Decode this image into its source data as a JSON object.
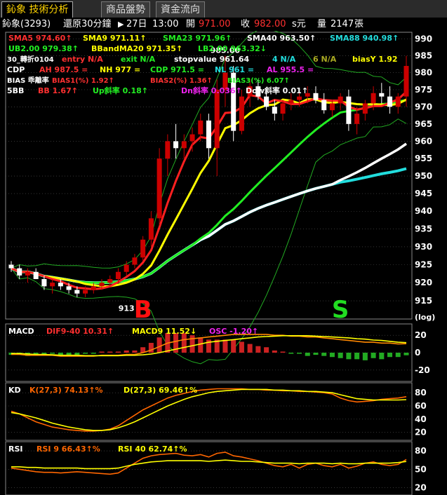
{
  "tabs": [
    {
      "label": "鈊象 技術分析",
      "active": true
    },
    {
      "label": "商品盤勢",
      "active": false
    },
    {
      "label": "資金流向",
      "active": false
    }
  ],
  "header": {
    "symbol": "鈊象(3293)",
    "period": "還原30分鐘",
    "day": "27日",
    "time": "13:00",
    "open_label": "開",
    "open": "971.00",
    "close_label": "收",
    "close": "982.00",
    "unit": "s元",
    "volume_label": "量",
    "volume": "2147",
    "volume_unit": "張"
  },
  "colors": {
    "sma5": "#ff2020",
    "sma9": "#ffff00",
    "sma23": "#22ee22",
    "sma40": "#ffffff",
    "sma88": "#22dddd",
    "up": "#cc0000",
    "down": "#ffffff",
    "grid": "#555",
    "border": "#888"
  },
  "indicators": [
    [
      {
        "t": "SMA5 974.60↑",
        "c": "#ff3030"
      },
      {
        "t": "SMA9 971.11↑",
        "c": "#ffff00"
      },
      {
        "t": "SMA23 971.96↑",
        "c": "#22ee22"
      },
      {
        "t": "SMA40 963.50↑",
        "c": "#ffffff"
      },
      {
        "t": "SMA88 940.98↑",
        "c": "#22dddd"
      }
    ],
    [
      {
        "t": "UB2.00 979.38↑",
        "c": "#22ee22"
      },
      {
        "t": "BBandMA20 971.35↑",
        "c": "#ffff00"
      },
      {
        "t": "LB2.00 963.32↓",
        "c": "#22ee22"
      }
    ],
    [
      {
        "t": "30_轉折0104",
        "c": "#ffffff"
      },
      {
        "t": "entry N/A",
        "c": "#ff3030"
      },
      {
        "t": "exit N/A",
        "c": "#22ee22"
      },
      {
        "t": "stopvalue 961.64",
        "c": "#ffffff"
      },
      {
        "t": "4 N/A",
        "c": "#22dddd"
      },
      {
        "t": "6 N/A",
        "c": "#aaaa22"
      },
      {
        "t": "biasY 1.92",
        "c": "#ffff00"
      }
    ],
    [
      {
        "t": "CDP",
        "c": "#ffffff"
      },
      {
        "t": "AH 987.5 =",
        "c": "#ff3030"
      },
      {
        "t": "NH 977 =",
        "c": "#ffff00"
      },
      {
        "t": "CDP 971.5 =",
        "c": "#22ee22"
      },
      {
        "t": "NL 961 =",
        "c": "#22dddd"
      },
      {
        "t": "AL 955.5 =",
        "c": "#ee22ee"
      }
    ],
    [
      {
        "t": "BIAS 乖離率",
        "c": "#ffffff"
      },
      {
        "t": "BIAS1(%) 1.92↑",
        "c": "#ff3030"
      },
      {
        "t": "BIAS2(%) 1.36↑",
        "c": "#ff3030"
      },
      {
        "t": "BIAS3(%) 6.07↑",
        "c": "#22ee22"
      }
    ],
    [
      {
        "t": "5BB",
        "c": "#ffffff"
      },
      {
        "t": "BB 1.67↑",
        "c": "#ff3030"
      },
      {
        "t": "Up斜率 0.18↑",
        "c": "#22ee22"
      },
      {
        "t": "Dn斜率 0.036↑",
        "c": "#ee22ee"
      },
      {
        "t": "Dow斜率 0.01↑",
        "c": "#ffffff"
      }
    ]
  ],
  "markers": {
    "buy": "B",
    "sell": "S",
    "low_label": "913",
    "high_label": "985.00"
  },
  "chart_data": [
    {
      "type": "candlestick",
      "y_ticks": [
        990,
        985,
        980,
        975,
        970,
        965,
        960,
        955,
        950,
        945,
        940,
        935,
        930,
        925,
        920,
        915
      ],
      "ylim": [
        910,
        992
      ],
      "y_scale": "log",
      "scale_label": "(log)",
      "candles": [
        [
          925,
          926,
          923,
          924
        ],
        [
          924,
          925,
          921,
          922
        ],
        [
          922,
          924,
          920,
          923
        ],
        [
          923,
          924,
          921,
          921
        ],
        [
          921,
          922,
          918,
          919
        ],
        [
          919,
          921,
          917,
          920
        ],
        [
          920,
          921,
          918,
          919
        ],
        [
          919,
          920,
          917,
          918
        ],
        [
          918,
          919,
          916,
          917
        ],
        [
          917,
          919,
          916,
          918
        ],
        [
          918,
          920,
          917,
          919
        ],
        [
          919,
          921,
          918,
          920
        ],
        [
          920,
          922,
          919,
          921
        ],
        [
          921,
          924,
          920,
          923
        ],
        [
          923,
          926,
          922,
          925
        ],
        [
          925,
          928,
          924,
          927
        ],
        [
          927,
          933,
          926,
          932
        ],
        [
          932,
          940,
          930,
          938
        ],
        [
          938,
          958,
          936,
          955
        ],
        [
          955,
          962,
          950,
          960
        ],
        [
          960,
          965,
          955,
          958
        ],
        [
          958,
          962,
          955,
          960
        ],
        [
          960,
          964,
          957,
          962
        ],
        [
          962,
          968,
          960,
          966
        ],
        [
          966,
          968,
          955,
          958
        ],
        [
          958,
          978,
          950,
          975
        ],
        [
          975,
          985,
          970,
          980
        ],
        [
          980,
          982,
          960,
          963
        ],
        [
          963,
          975,
          962,
          973
        ],
        [
          973,
          978,
          970,
          976
        ],
        [
          976,
          978,
          972,
          973
        ],
        [
          973,
          975,
          969,
          970
        ],
        [
          970,
          972,
          966,
          968
        ],
        [
          968,
          972,
          966,
          971
        ],
        [
          971,
          974,
          969,
          972
        ],
        [
          972,
          975,
          970,
          973
        ],
        [
          973,
          976,
          971,
          974
        ],
        [
          974,
          976,
          971,
          972
        ],
        [
          972,
          974,
          968,
          969
        ],
        [
          969,
          972,
          967,
          971
        ],
        [
          971,
          974,
          969,
          973
        ],
        [
          973,
          975,
          963,
          965
        ],
        [
          965,
          970,
          962,
          968
        ],
        [
          968,
          972,
          966,
          971
        ],
        [
          971,
          976,
          969,
          974
        ],
        [
          974,
          977,
          971,
          973
        ],
        [
          973,
          976,
          968,
          970
        ],
        [
          970,
          974,
          968,
          973
        ],
        [
          973,
          985,
          970,
          982
        ]
      ]
    },
    {
      "type": "line",
      "name": "MACD",
      "labels": [
        {
          "t": "MACD",
          "c": "#ffffff"
        },
        {
          "t": "DIF9-40 10.31↑",
          "c": "#ff3030"
        },
        {
          "t": "MACD9 11.52↓",
          "c": "#ffff00"
        },
        {
          "t": "OSC -1.20↑",
          "c": "#ee22ee"
        }
      ],
      "y_ticks": [
        20,
        0,
        -20
      ],
      "ylim": [
        -33,
        33
      ],
      "dif": [
        -2,
        -2,
        -3,
        -3,
        -3,
        -3,
        -4,
        -4,
        -4,
        -4,
        -4,
        -3,
        -3,
        -3,
        -2,
        -2,
        0,
        3,
        7,
        11,
        13,
        15,
        16,
        17,
        18,
        19,
        20,
        21,
        21,
        21,
        21,
        21,
        20,
        20,
        19,
        19,
        18,
        18,
        17,
        16,
        15,
        14,
        13,
        12,
        12,
        11,
        11,
        10,
        10.3
      ],
      "macd9": [
        -1,
        -1,
        -1.5,
        -2,
        -2,
        -2.5,
        -3,
        -3,
        -3,
        -3.5,
        -3.5,
        -3.5,
        -3.5,
        -3.5,
        -3,
        -3,
        -2.5,
        -1.5,
        0,
        2,
        4,
        6,
        8,
        10,
        12,
        13,
        14,
        15,
        16,
        17,
        18,
        18.5,
        19,
        19.5,
        19.5,
        19.5,
        19.5,
        19,
        18.5,
        18,
        17.5,
        17,
        16,
        15.5,
        14.5,
        14,
        13,
        12,
        11.5
      ]
    },
    {
      "type": "line",
      "name": "KD",
      "labels": [
        {
          "t": "KD",
          "c": "#ffffff"
        },
        {
          "t": "K(27,3) 74.13↑%",
          "c": "#ff6600"
        },
        {
          "t": "D(27,3) 69.46↑%",
          "c": "#ffff00"
        }
      ],
      "y_ticks": [
        80,
        60,
        40,
        20
      ],
      "ylim": [
        8,
        95
      ],
      "k": [
        52,
        48,
        42,
        36,
        32,
        28,
        26,
        24,
        23,
        22,
        22,
        23,
        25,
        30,
        38,
        46,
        54,
        60,
        66,
        72,
        76,
        79,
        82,
        84,
        85,
        86,
        86,
        86,
        86,
        85,
        85,
        84,
        84,
        83,
        83,
        82,
        82,
        81,
        80,
        78,
        72,
        68,
        66,
        67,
        68,
        70,
        71,
        72,
        74
      ],
      "d": [
        50,
        48,
        45,
        42,
        38,
        34,
        31,
        28,
        26,
        24,
        23,
        23,
        24,
        27,
        31,
        36,
        42,
        48,
        54,
        60,
        65,
        70,
        74,
        77,
        80,
        82,
        83,
        84,
        85,
        85,
        85,
        85,
        84,
        84,
        83,
        83,
        82,
        82,
        81,
        80,
        77,
        74,
        71,
        70,
        69,
        69,
        69,
        69,
        69.5
      ]
    },
    {
      "type": "line",
      "name": "RSI",
      "labels": [
        {
          "t": "RSI",
          "c": "#ffffff"
        },
        {
          "t": "RSI 9 66.43↑%",
          "c": "#ff6600"
        },
        {
          "t": "RSI 40 62.74↑%",
          "c": "#ffff00"
        }
      ],
      "y_ticks": [
        80,
        50,
        20
      ],
      "ylim": [
        8,
        95
      ],
      "rsi9": [
        52,
        50,
        48,
        46,
        45,
        45,
        44,
        45,
        46,
        45,
        44,
        43,
        42,
        44,
        52,
        60,
        68,
        72,
        74,
        75,
        76,
        73,
        72,
        74,
        70,
        76,
        78,
        72,
        70,
        67,
        64,
        60,
        56,
        54,
        58,
        52,
        58,
        60,
        56,
        54,
        58,
        52,
        55,
        60,
        62,
        58,
        56,
        58,
        66
      ],
      "rsi40": [
        54,
        54,
        53,
        53,
        52,
        52,
        52,
        52,
        52,
        51,
        51,
        51,
        51,
        52,
        55,
        58,
        60,
        62,
        63,
        64,
        64,
        64,
        64,
        64,
        63,
        64,
        65,
        64,
        63,
        63,
        62,
        61,
        60,
        60,
        60,
        59,
        60,
        60,
        60,
        59,
        60,
        59,
        59,
        60,
        60,
        60,
        60,
        61,
        62.7
      ]
    }
  ]
}
